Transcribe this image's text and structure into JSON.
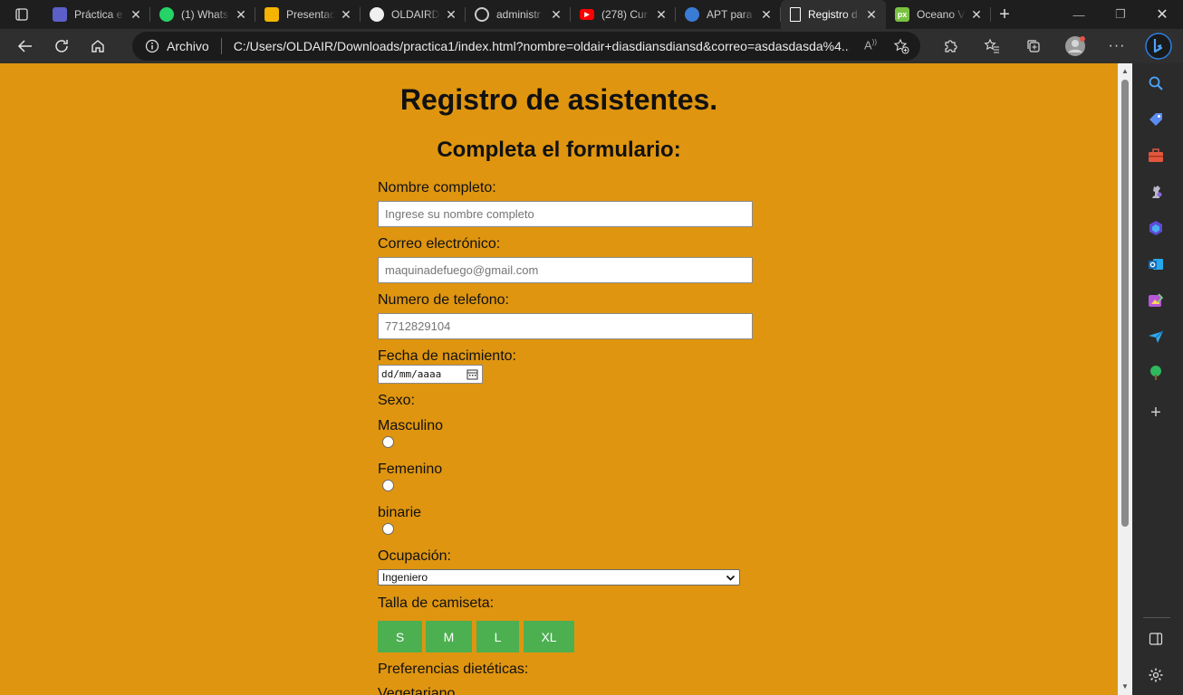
{
  "browser": {
    "tabs": [
      {
        "title": "Práctica e",
        "icon": "teams-icon",
        "color": "#5b5fc7"
      },
      {
        "title": "(1) Whats",
        "icon": "whatsapp-icon",
        "color": "#25d366"
      },
      {
        "title": "Presentac",
        "icon": "slides-icon",
        "color": "#f4b400"
      },
      {
        "title": "OLDAIRD",
        "icon": "github-icon",
        "color": "#f0f0f0"
      },
      {
        "title": "administr",
        "icon": "google-icon",
        "color": "#cccccc"
      },
      {
        "title": "(278) Cur",
        "icon": "youtube-icon",
        "color": "#ff0000"
      },
      {
        "title": "APT para",
        "icon": "globe-icon",
        "color": "#3a7bd5"
      },
      {
        "title": "Registro d",
        "icon": "page-icon",
        "color": "#ffffff",
        "active": true
      },
      {
        "title": "Oceano V",
        "icon": "px-icon",
        "color": "#7ac142"
      }
    ],
    "address": {
      "label": "Archivo",
      "url": "C:/Users/OLDAIR/Downloads/practica1/index.html?nombre=oldair+diasdiansdiansd&correo=asdasdasda%4..."
    }
  },
  "page": {
    "title": "Registro de asistentes.",
    "subtitle": "Completa el formulario:",
    "nombre": {
      "label": "Nombre completo:",
      "placeholder": "Ingrese su nombre completo"
    },
    "correo": {
      "label": "Correo electrónico:",
      "placeholder": "maquinadefuego@gmail.com"
    },
    "telefono": {
      "label": "Numero de telefono:",
      "placeholder": "7712829104"
    },
    "fecha": {
      "label": "Fecha de nacimiento:",
      "placeholder": "dd/mm/aaaa"
    },
    "sexo": {
      "label": "Sexo:",
      "options": [
        "Masculino",
        "Femenino",
        "binarie"
      ]
    },
    "ocupacion": {
      "label": "Ocupación:",
      "selected": "Ingeniero"
    },
    "talla": {
      "label": "Talla de camiseta:",
      "sizes": [
        "S",
        "M",
        "L",
        "XL"
      ]
    },
    "preferencias": {
      "label": "Preferencias dietéticas:",
      "first_option": "Vegetariano"
    }
  },
  "colors": {
    "page_background": "#df950f",
    "size_button": "#4caf50"
  }
}
